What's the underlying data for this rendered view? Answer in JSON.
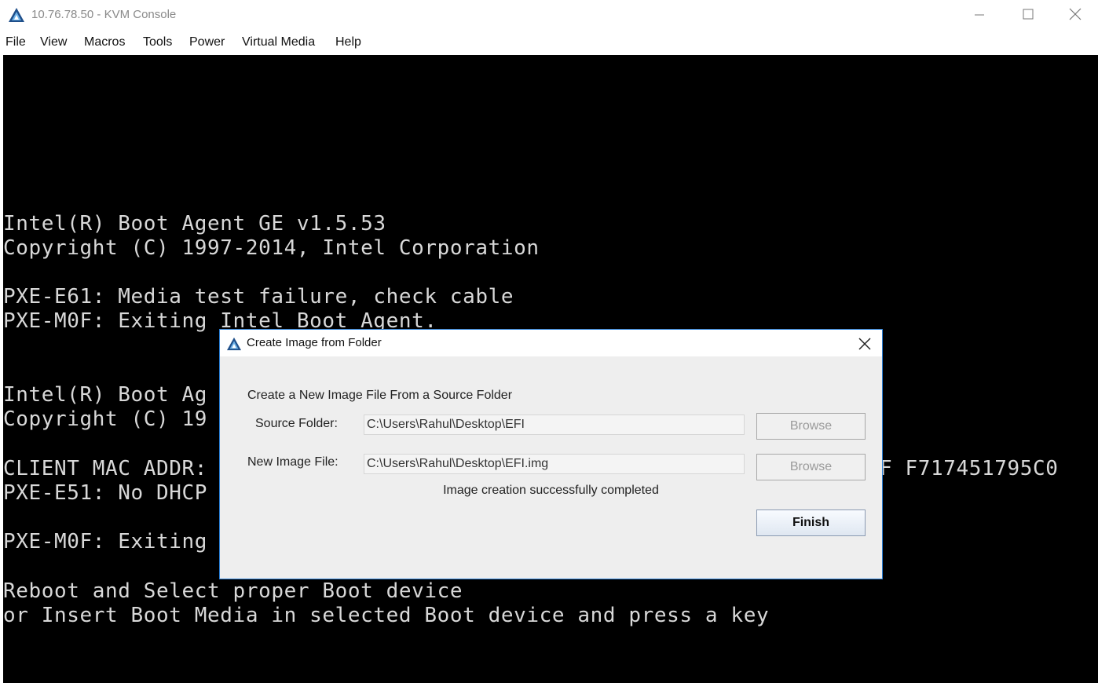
{
  "window": {
    "title": "10.76.78.50 - KVM Console",
    "icon": "kvm-triangle-icon",
    "controls": [
      "minimize-icon",
      "maximize-icon",
      "close-icon"
    ]
  },
  "menu": {
    "items": [
      "File",
      "View",
      "Macros",
      "Tools",
      "Power",
      "Virtual Media",
      "Help"
    ]
  },
  "console": {
    "lines": [
      "Intel(R) Boot Agent GE v1.5.53",
      "Copyright (C) 1997-2014, Intel Corporation",
      "PXE-E61: Media test failure, check cable",
      "PXE-M0F: Exiting Intel Boot Agent.",
      "Intel(R) Boot Ag",
      "Copyright (C) 19",
      "CLIENT MAC ADDR:",
      "F F717451795C0",
      "PXE-E51: No DHCP",
      "PXE-M0F: Exiting",
      "Reboot and Select proper Boot device",
      "or Insert Boot Media in selected Boot device and press a key"
    ]
  },
  "dialog": {
    "title": "Create Image from Folder",
    "heading": "Create a New Image File From a Source Folder",
    "source_label": "Source Folder:",
    "source_value": "C:\\Users\\Rahul\\Desktop\\EFI",
    "image_label": "New Image File:",
    "image_value": "C:\\Users\\Rahul\\Desktop\\EFI.img",
    "browse_label": "Browse",
    "status": "Image creation successfully completed",
    "finish_label": "Finish"
  },
  "colors": {
    "console_bg": "#000000",
    "console_text": "#d8d8d8",
    "dialog_bg": "#eeeeee",
    "dialog_border": "#2b7fd6"
  }
}
